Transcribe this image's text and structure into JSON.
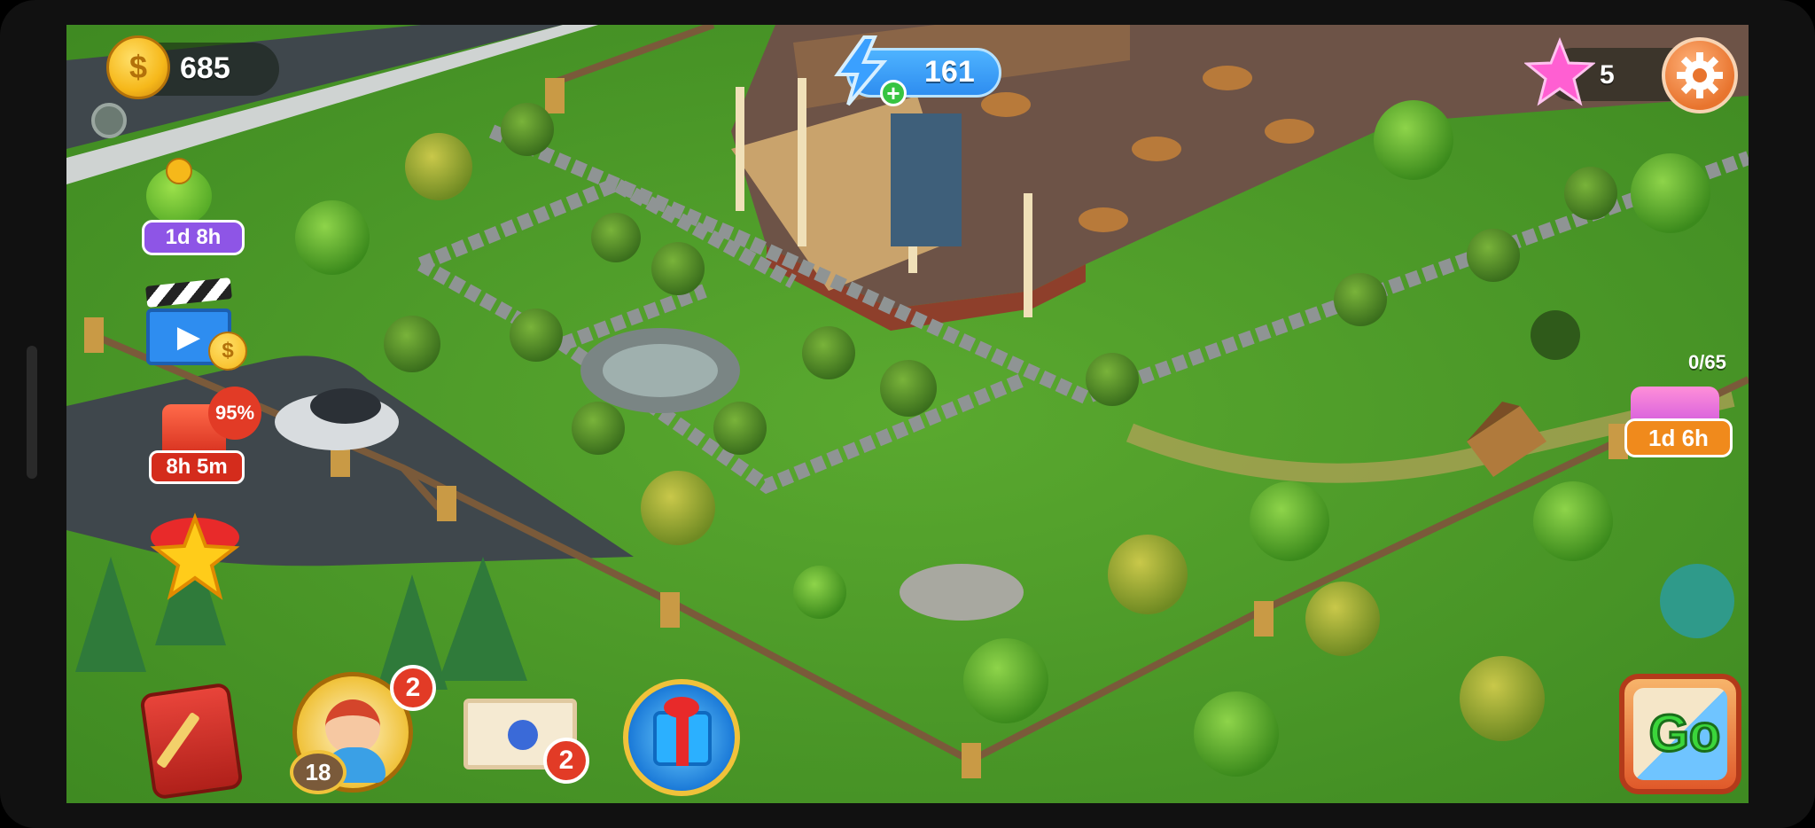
{
  "hud": {
    "coins": "685",
    "energy": "161",
    "stars": "5"
  },
  "left_offers": {
    "money_tree_timer": "1d 8h",
    "sale_percent": "95%",
    "sale_timer": "8h 5m"
  },
  "right_event": {
    "progress": "0/65",
    "timer": "1d 6h"
  },
  "bottom": {
    "friends_badge": "2",
    "level": "18",
    "mail_badge": "2",
    "go_label": "Go"
  },
  "icons": [
    "coin-icon",
    "energy-icon",
    "plus-icon",
    "star-icon",
    "gear-icon",
    "money-tree-icon",
    "video-ad-icon",
    "sale-gift-icon",
    "ribbon-star-icon",
    "journal-icon",
    "avatar-icon",
    "mail-icon",
    "gift-box-icon",
    "chest-icon",
    "go-icon"
  ],
  "colors": {
    "grass": "#4f9a2a",
    "road": "#3f474c",
    "coin": "#f6b81a",
    "energy": "#2e8df0",
    "star": "#ff5fd2",
    "badge": "#e23b26",
    "timer_purple": "#8e55e6",
    "timer_orange": "#f08a1c"
  }
}
